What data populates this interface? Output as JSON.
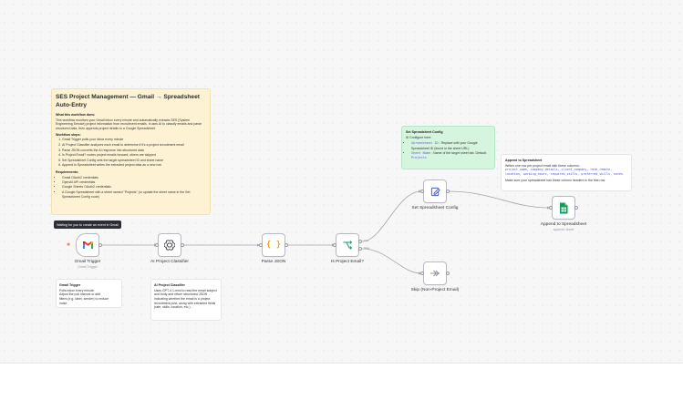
{
  "overview_note": {
    "title": "SES Project Management — Gmail → Spreadsheet Auto-Entry",
    "what_heading": "What this workflow does:",
    "what_text": "This workflow monitors your Gmail inbox every minute and automatically extracts SES (System Engineering Service) project information from recruitment emails. It uses AI to classify emails and parse structured data, then appends project details to a Google Spreadsheet.",
    "steps_heading": "Workflow steps:",
    "steps": [
      "Gmail Trigger polls your inbox every minute",
      "AI Project Classifier analyzes each email to determine if it's a project recruitment email",
      "Parse JSON converts the AI response into structured data",
      "Is Project Email? routes project emails forward; others are skipped",
      "Set Spreadsheet Config sets the target spreadsheet ID and sheet name",
      "Append to Spreadsheet writes the extracted project data as a new row"
    ],
    "req_heading": "Requirements:",
    "requirements": [
      "Gmail OAuth2 credentials",
      "OpenAI API credentials",
      "Google Sheets OAuth2 credentials",
      "A Google Spreadsheet with a sheet named \"Projects\" (or update the sheet name in the Set Spreadsheet Config node)"
    ]
  },
  "config_note": {
    "title": "Set Spreadsheet Config",
    "line": "⚙ Configure here:",
    "items": [
      {
        "key": "Spreadsheet ID:",
        "text": "Replace with your Google Spreadsheet ID (found in the sheet URL)"
      },
      {
        "key": "Sheet Name:",
        "text": "Name of the target sheet tab. Default: ",
        "code": "Projects"
      }
    ]
  },
  "append_note": {
    "title": "Append to Spreadsheet",
    "line1": "Writes one row per project email with these columns:",
    "columns": "project_name, company_details, client_company, rate_remote, location, working_hours, required_skills, preferred_skills, notes",
    "line2": "Make sure your spreadsheet has these column headers in the first row."
  },
  "trigger_note": {
    "title": "Gmail Trigger",
    "lines": [
      "Polls inbox every minute.",
      "Adjust the poll interval or add",
      "filters (e.g. label, sender) to reduce",
      "noise."
    ]
  },
  "ai_note": {
    "title": "AI Project Classifier",
    "text": "Uses GPT-4.1-mini to read the email subject and body and return structured JSON indicating whether the email is a project recruitment post, along with extracted fields (rate, skills, location, etc.)."
  },
  "tooltip": "Waiting for you to create an event in Gmail",
  "nodes": {
    "gmail": {
      "label": "Gmail Trigger",
      "sub": "Gmail Trigger",
      "icon": "gmail-icon"
    },
    "ai": {
      "label": "AI Project Classifier",
      "icon": "openai-icon"
    },
    "parse": {
      "label": "Parse JSON",
      "icon": "code-braces-icon"
    },
    "if": {
      "label": "Is Project Email?",
      "icon": "branch-icon",
      "true_label": "true",
      "false_label": "false"
    },
    "set": {
      "label": "Set Spreadsheet Config",
      "icon": "pen-icon"
    },
    "skip": {
      "label": "Skip (Non-Project Email)",
      "icon": "no-op-icon"
    },
    "append": {
      "label": "Append to Spreadsheet",
      "sub": "append: sheet",
      "icon": "google-sheets-icon"
    }
  },
  "colors": {
    "overview_note_bg": "#fdf3d4",
    "config_note_bg": "#d6f5df",
    "gmail_red": "#ea4335",
    "sheets_green": "#0f9d58",
    "code_orange": "#f0a028",
    "edge_gray": "#9b9ba5"
  }
}
